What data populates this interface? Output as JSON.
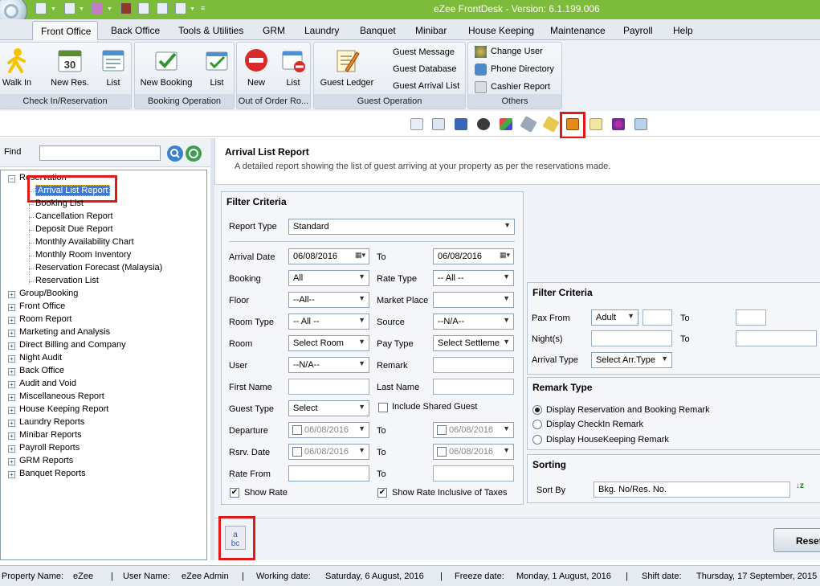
{
  "app": {
    "title": "eZee FrontDesk - Version: 6.1.199.006"
  },
  "menu": {
    "items": [
      "Front Office",
      "Back Office",
      "Tools & Utilities",
      "GRM",
      "Laundry",
      "Banquet",
      "Minibar",
      "House Keeping",
      "Maintenance",
      "Payroll",
      "Help"
    ]
  },
  "ribbon": {
    "checkin": {
      "label": "Check In/Reservation",
      "walk_in": "Walk In",
      "new_res": "New Res.",
      "list": "List"
    },
    "booking": {
      "label": "Booking Operation",
      "new_booking": "New Booking",
      "list": "List"
    },
    "out_of_order": {
      "label": "Out of Order Ro...",
      "new": "New",
      "list": "List"
    },
    "guest_op": {
      "label": "Guest Operation",
      "guest_ledger": "Guest Ledger",
      "guest_message": "Guest Message",
      "guest_database": "Guest Database",
      "guest_arrival_list": "Guest Arrival List"
    },
    "others": {
      "label": "Others",
      "change_user": "Change User",
      "phone_directory": "Phone Directory",
      "cashier_report": "Cashier Report"
    }
  },
  "find": {
    "label": "Find",
    "value": ""
  },
  "tree": {
    "reservation": "Reservation",
    "reservation_children": [
      "Arrival List Report",
      "Booking List",
      "Cancellation Report",
      "Deposit Due Report",
      "Monthly Availability Chart",
      "Monthly Room Inventory",
      "Reservation Forecast (Malaysia)",
      "Reservation List"
    ],
    "groups": [
      "Group/Booking",
      "Front Office",
      "Room Report",
      "Marketing and Analysis",
      "Direct Billing and Company",
      "Night Audit",
      "Back Office",
      "Audit and Void",
      "Miscellaneous Report",
      "House Keeping Report",
      "Laundry Reports",
      "Minibar Reports",
      "Payroll Reports",
      "GRM Reports",
      "Banquet Reports"
    ]
  },
  "report": {
    "title": "Arrival List Report",
    "description": "A detailed report showing the list of guest arriving at your property as per the reservations made."
  },
  "filter1": {
    "title": "Filter Criteria",
    "report_type_label": "Report Type",
    "report_type": "Standard",
    "arrival_date_label": "Arrival Date",
    "arrival_date": "06/08/2016",
    "to": "To",
    "arrival_to": "06/08/2016",
    "booking_label": "Booking",
    "booking": "All",
    "rate_type_label": "Rate Type",
    "rate_type": "-- All --",
    "floor_label": "Floor",
    "floor": "--All--",
    "market_place_label": "Market Place",
    "market_place": "",
    "room_type_label": "Room Type",
    "room_type": "-- All --",
    "source_label": "Source",
    "source": "--N/A--",
    "room_label": "Room",
    "room": "Select Room",
    "pay_type_label": "Pay Type",
    "pay_type": "Select Settleme",
    "user_label": "User",
    "user": "--N/A--",
    "remark_label": "Remark",
    "remark": "",
    "first_name_label": "First Name",
    "first_name": "",
    "last_name_label": "Last Name",
    "last_name": "",
    "guest_type_label": "Guest Type",
    "guest_type": "Select",
    "include_shared_guest": "Include Shared Guest",
    "departure_label": "Departure",
    "departure_from": "06/08/2016",
    "departure_to": "06/08/2016",
    "rsrv_date_label": "Rsrv. Date",
    "rsrv_from": "06/08/2016",
    "rsrv_to": "06/08/2016",
    "rate_from_label": "Rate From",
    "rate_from": "",
    "rate_to": "",
    "show_rate": "Show Rate",
    "show_rate_inclusive": "Show Rate Inclusive of Taxes"
  },
  "filter2": {
    "title": "Filter Criteria",
    "pax_from_label": "Pax From",
    "pax_type": "Adult",
    "pax_from": "",
    "to": "To",
    "pax_to": "",
    "nights_label": "Night(s)",
    "nights_from": "",
    "nights_to": "",
    "arrival_type_label": "Arrival Type",
    "arrival_type": "Select Arr.Type"
  },
  "remark_type": {
    "title": "Remark Type",
    "options": [
      "Display Reservation and Booking Remark",
      "Display CheckIn Remark",
      "Display HouseKeeping Remark"
    ]
  },
  "sorting": {
    "title": "Sorting",
    "sort_by_label": "Sort By",
    "sort_by": "Bkg. No/Res. No."
  },
  "buttons": {
    "reset": "Reset"
  },
  "status": {
    "property_label": "Property Name:",
    "property": "eZee",
    "user_label": "User Name:",
    "user": "eZee Admin",
    "working_label": "Working date:",
    "working": "Saturday, 6 August, 2016",
    "freeze_label": "Freeze date:",
    "freeze": "Monday, 1 August, 2016",
    "shift_label": "Shift date:",
    "shift": "Thursday, 17 September, 2015",
    "separator": "|"
  },
  "colors": {
    "accent": "#7dbb3b",
    "highlight": "#e01818",
    "selection": "#3a78d4"
  }
}
